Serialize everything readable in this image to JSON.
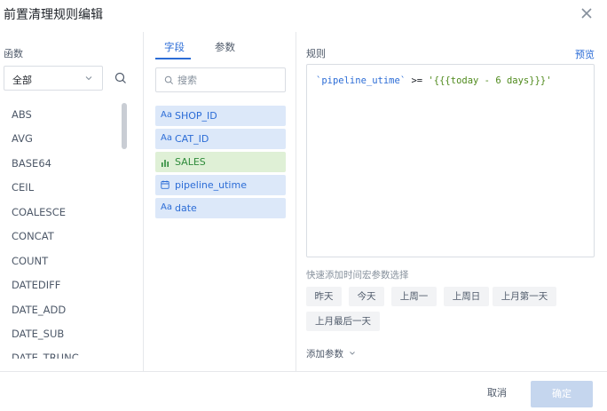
{
  "dialog": {
    "title": "前置清理规则编辑"
  },
  "functions": {
    "label": "函数",
    "category_selected": "全部",
    "items": [
      "ABS",
      "AVG",
      "BASE64",
      "CEIL",
      "COALESCE",
      "CONCAT",
      "COUNT",
      "DATEDIFF",
      "DATE_ADD",
      "DATE_SUB",
      "DATE_TRUNC"
    ]
  },
  "fields_panel": {
    "tabs": [
      "字段",
      "参数"
    ],
    "search_placeholder": "搜索",
    "fields": [
      {
        "type": "text",
        "icon": "Aa",
        "name": "SHOP_ID"
      },
      {
        "type": "text",
        "icon": "Aa",
        "name": "CAT_ID"
      },
      {
        "type": "number",
        "icon": "ılı",
        "name": "SALES"
      },
      {
        "type": "date",
        "icon": "date",
        "name": "pipeline_utime"
      },
      {
        "type": "text",
        "icon": "Aa",
        "name": "date"
      }
    ]
  },
  "rule": {
    "label": "规则",
    "preview_label": "预览",
    "expr_field": "`pipeline_utime`",
    "expr_op": ">=",
    "expr_value": "'{{{today - 6 days}}}'",
    "quick_label": "快速添加时间宏参数选择",
    "quick_options": [
      "昨天",
      "今天",
      "上周一",
      "上周日",
      "上月第一天",
      "上月最后一天"
    ],
    "add_param_label": "添加参数"
  },
  "footer": {
    "cancel_label": "取消",
    "ok_label": "确定"
  },
  "colors": {
    "accent": "#2b6cd6",
    "text_field_bg": "#dce8f9",
    "number_field_bg": "#dff0d6",
    "ok_disabled": "#c5d6ee"
  }
}
